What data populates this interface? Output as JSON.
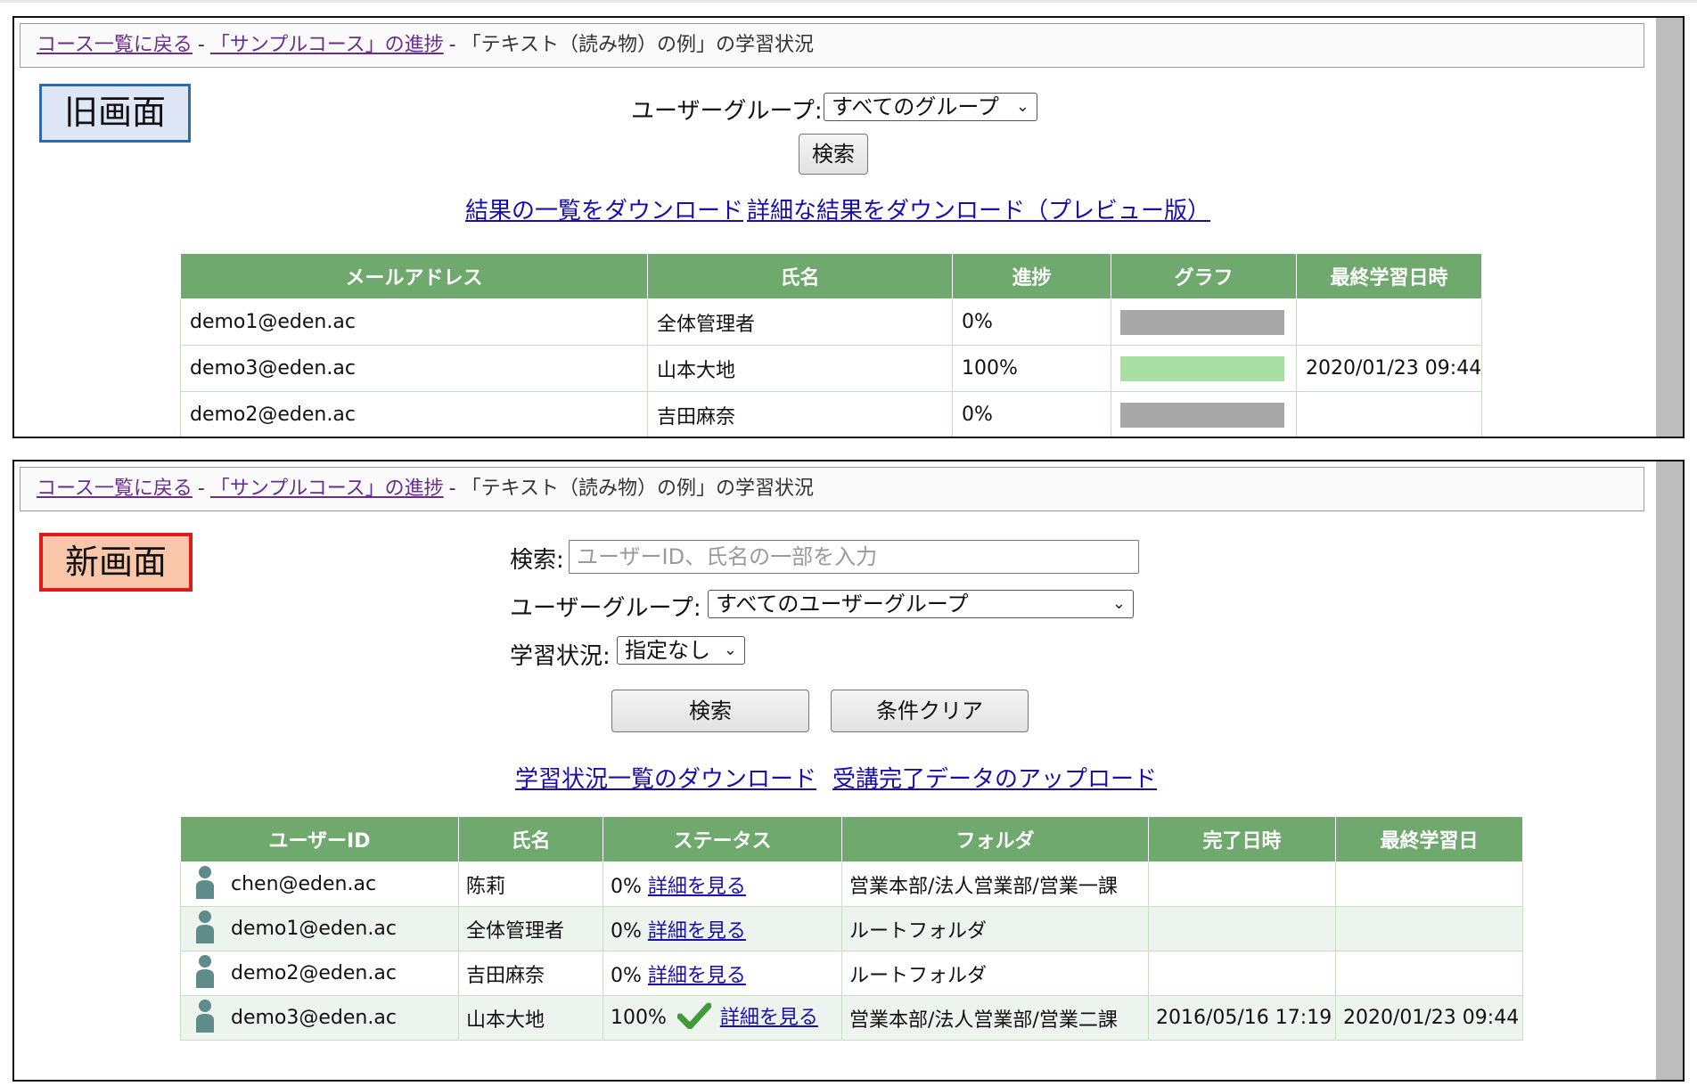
{
  "breadcrumb": {
    "back": "コース一覧に戻る",
    "sep": "-",
    "course": "「サンプルコース」の進捗",
    "current": "「テキスト（読み物）の例」の学習状況"
  },
  "old_screen": {
    "tag": "旧画面",
    "group_label": "ユーザーグループ:",
    "group_value": "すべてのグループ",
    "search_button": "検索",
    "download_list": "結果の一覧をダウンロード",
    "download_detail": "詳細な結果をダウンロード（プレビュー版）",
    "columns": [
      "メールアドレス",
      "氏名",
      "進捗",
      "グラフ",
      "最終学習日時"
    ],
    "rows": [
      {
        "email": "demo1@eden.ac",
        "name": "全体管理者",
        "progress": "0%",
        "progress_value": 0,
        "last": ""
      },
      {
        "email": "demo3@eden.ac",
        "name": "山本大地",
        "progress": "100%",
        "progress_value": 1,
        "last": "2020/01/23 09:44"
      },
      {
        "email": "demo2@eden.ac",
        "name": "吉田麻奈",
        "progress": "0%",
        "progress_value": 0,
        "last": ""
      }
    ]
  },
  "new_screen": {
    "tag": "新画面",
    "search_label": "検索:",
    "search_placeholder": "ユーザーID、氏名の一部を入力",
    "group_label": "ユーザーグループ:",
    "group_value": "すべてのユーザーグループ",
    "status_label": "学習状況:",
    "status_value": "指定なし",
    "search_button": "検索",
    "clear_button": "条件クリア",
    "download_link": "学習状況一覧のダウンロード",
    "upload_link": "受講完了データのアップロード",
    "columns": [
      "ユーザーID",
      "氏名",
      "ステータス",
      "フォルダ",
      "完了日時",
      "最終学習日"
    ],
    "rows": [
      {
        "user_id": "chen@eden.ac",
        "name": "陈莉",
        "status": "0%",
        "detail": "詳細を見る",
        "folder": "営業本部/法人営業部/営業一課",
        "completed": "",
        "last": ""
      },
      {
        "user_id": "demo1@eden.ac",
        "name": "全体管理者",
        "status": "0%",
        "detail": "詳細を見る",
        "folder": "ルートフォルダ",
        "completed": "",
        "last": ""
      },
      {
        "user_id": "demo2@eden.ac",
        "name": "吉田麻奈",
        "status": "0%",
        "detail": "詳細を見る",
        "folder": "ルートフォルダ",
        "completed": "",
        "last": ""
      },
      {
        "user_id": "demo3@eden.ac",
        "name": "山本大地",
        "status": "100%",
        "detail": "詳細を見る",
        "folder": "営業本部/法人営業部/営業二課",
        "completed": "2016/05/16 17:19",
        "last": "2020/01/23 09:44"
      }
    ]
  },
  "colors": {
    "header_green": "#6fa96d",
    "bar_gray": "#a8a8a8",
    "bar_green": "#a9dfa3",
    "check_green": "#3f9a3a",
    "user_icon": "#5f8c8a",
    "old_tag_border": "#2f6ba8",
    "new_tag_border": "#e01a1a"
  },
  "icons": {
    "user": "user-icon",
    "check": "check-icon",
    "caret": "chevron-down-icon"
  }
}
